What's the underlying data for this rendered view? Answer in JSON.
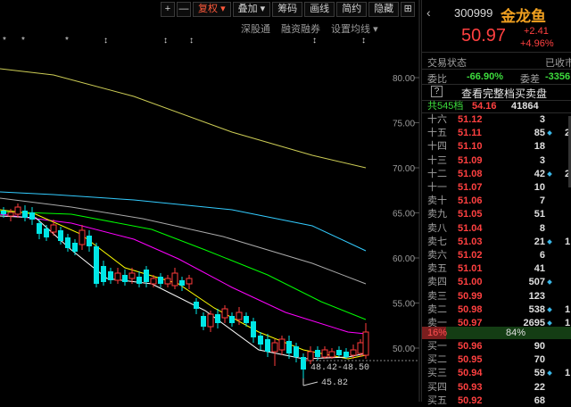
{
  "toolbar": {
    "plus": "+",
    "minus": "—",
    "adjust": "复权",
    "overlay": "叠加",
    "chips": "筹码",
    "draw": "画线",
    "simple": "简约",
    "hide": "隐藏",
    "grid_icon": "grid-icon"
  },
  "subbar": {
    "shenzhen_connect": "深股通",
    "margin": "融资融券",
    "ma_settings": "设置均线"
  },
  "chart": {
    "price_ticks": [
      "80.00",
      "75.00",
      "70.00",
      "65.00",
      "60.00",
      "55.00",
      "50.00"
    ],
    "high_annotation": "48.42-48.50",
    "low_annotation": "45.82",
    "marker_symbols": [
      "*",
      "*",
      "*",
      "↕",
      "↕",
      "↕",
      "↕",
      "↕"
    ]
  },
  "colors": {
    "up": "#ff3c3c",
    "down": "#00e6e6",
    "ma5": "#ffffff",
    "ma10": "#ffff00",
    "ma20": "#ff00ff",
    "ma30": "#00ff00",
    "ma60": "#aaaaaa",
    "ma120": "#33ccff",
    "ma250": "#cccc55"
  },
  "stock": {
    "code": "300999",
    "name": "金龙鱼",
    "price": "50.97",
    "change": "+2.41",
    "change_pct": "+4.96%"
  },
  "status": {
    "label": "交易状态",
    "value": "已收市"
  },
  "ratio": {
    "label": "委比",
    "value": "-66.90%",
    "diff_label": "委差",
    "diff_value": "-3356"
  },
  "view_full_book": "查看完整档买卖盘",
  "help_icon": "?",
  "summary": {
    "total": "共545档",
    "avg_price": "54.16",
    "volume": "41864"
  },
  "asks": [
    {
      "label": "十六",
      "price": "51.12",
      "vol": "3",
      "mark": false,
      "ext": ""
    },
    {
      "label": "十五",
      "price": "51.11",
      "vol": "85",
      "mark": true,
      "ext": "2"
    },
    {
      "label": "十四",
      "price": "51.10",
      "vol": "18",
      "mark": false,
      "ext": ""
    },
    {
      "label": "十三",
      "price": "51.09",
      "vol": "3",
      "mark": false,
      "ext": ""
    },
    {
      "label": "十二",
      "price": "51.08",
      "vol": "42",
      "mark": true,
      "ext": "2"
    },
    {
      "label": "十一",
      "price": "51.07",
      "vol": "10",
      "mark": false,
      "ext": ""
    },
    {
      "label": "卖十",
      "price": "51.06",
      "vol": "7",
      "mark": false,
      "ext": ""
    },
    {
      "label": "卖九",
      "price": "51.05",
      "vol": "51",
      "mark": false,
      "ext": ""
    },
    {
      "label": "卖八",
      "price": "51.04",
      "vol": "8",
      "mark": false,
      "ext": ""
    },
    {
      "label": "卖七",
      "price": "51.03",
      "vol": "21",
      "mark": true,
      "ext": "1"
    },
    {
      "label": "卖六",
      "price": "51.02",
      "vol": "6",
      "mark": false,
      "ext": ""
    },
    {
      "label": "卖五",
      "price": "51.01",
      "vol": "41",
      "mark": false,
      "ext": ""
    },
    {
      "label": "卖四",
      "price": "51.00",
      "vol": "507",
      "mark": true,
      "ext": ""
    },
    {
      "label": "卖三",
      "price": "50.99",
      "vol": "123",
      "mark": false,
      "ext": ""
    },
    {
      "label": "卖二",
      "price": "50.98",
      "vol": "538",
      "mark": true,
      "ext": "1"
    },
    {
      "label": "卖一",
      "price": "50.97",
      "vol": "2695",
      "mark": true,
      "ext": "1"
    }
  ],
  "split": {
    "buy_pct": "16%",
    "buy_fraction": 0.16,
    "sell_pct": "84%"
  },
  "bids": [
    {
      "label": "买一",
      "price": "50.96",
      "vol": "90",
      "mark": false,
      "ext": ""
    },
    {
      "label": "买二",
      "price": "50.95",
      "vol": "70",
      "mark": false,
      "ext": ""
    },
    {
      "label": "买三",
      "price": "50.94",
      "vol": "59",
      "mark": true,
      "ext": "1"
    },
    {
      "label": "买四",
      "price": "50.93",
      "vol": "22",
      "mark": false,
      "ext": ""
    },
    {
      "label": "买五",
      "price": "50.92",
      "vol": "68",
      "mark": false,
      "ext": ""
    }
  ]
}
